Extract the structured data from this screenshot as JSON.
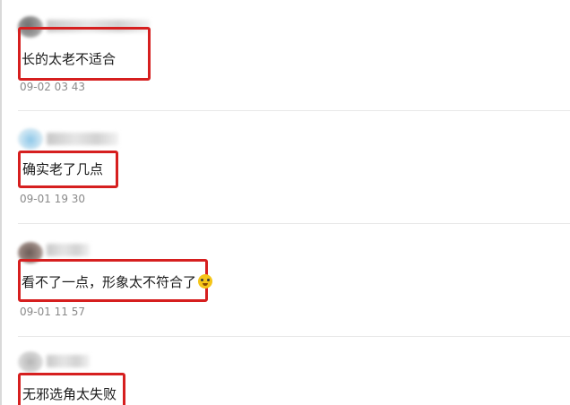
{
  "comments": [
    {
      "text": "长的太老不适合",
      "time": "09-02 03 43",
      "emoji": ""
    },
    {
      "text": "确实老了几点",
      "time": "09-01 19 30",
      "emoji": ""
    },
    {
      "text": "看不了一点，形象太不符合了",
      "time": "09-01 11 57",
      "emoji": "laughing-tears-emoji"
    },
    {
      "text": "无邪选角太失败",
      "time": "",
      "emoji": ""
    }
  ],
  "colors": {
    "highlight_border": "#d61f1f",
    "timestamp": "#8a8a8a",
    "text": "#1a1a1a",
    "divider": "#e8e8e8"
  }
}
